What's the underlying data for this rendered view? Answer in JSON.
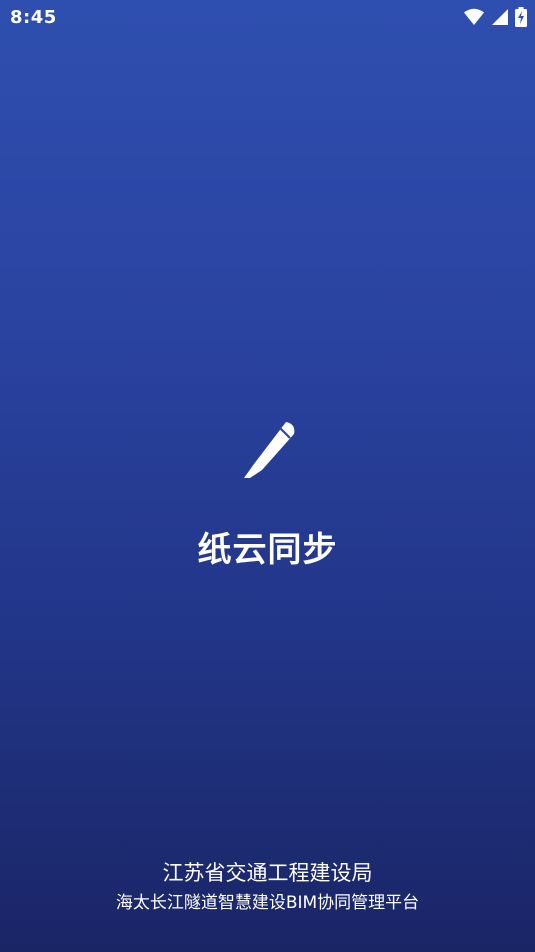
{
  "status_bar": {
    "time": "8:45",
    "icons": [
      "wifi-icon",
      "cellular-signal-icon",
      "battery-charging-icon"
    ]
  },
  "splash": {
    "logo_icon": "pen-icon",
    "app_title": "纸云同步"
  },
  "footer": {
    "organization": "江苏省交通工程建设局",
    "platform": "海太长江隧道智慧建设BIM协同管理平台"
  },
  "colors": {
    "background_top": "#2F4FB0",
    "background_bottom": "#1A2566",
    "text": "#FFFFFF"
  }
}
